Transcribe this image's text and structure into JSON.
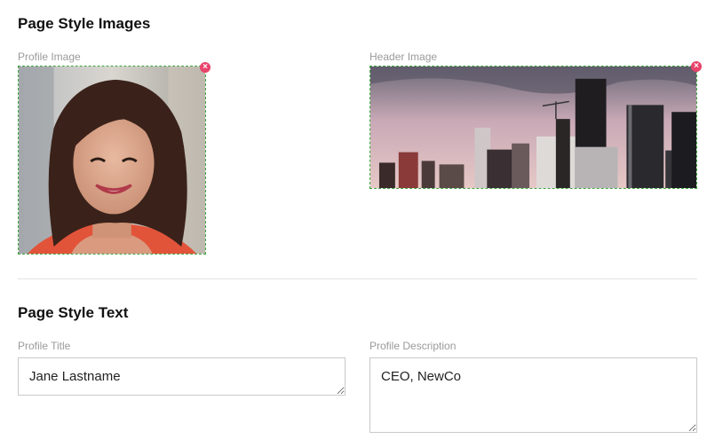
{
  "images_section": {
    "title": "Page Style Images",
    "profile_label": "Profile Image",
    "header_label": "Header Image",
    "remove_glyph": "×"
  },
  "text_section": {
    "title": "Page Style Text",
    "profile_title_label": "Profile Title",
    "profile_title_value": "Jane Lastname",
    "profile_description_label": "Profile Description",
    "profile_description_value": "CEO, NewCo"
  },
  "colors": {
    "dropzone_border": "#3fa33f",
    "remove_button": "#e8436b",
    "label": "#9a9a9a"
  }
}
